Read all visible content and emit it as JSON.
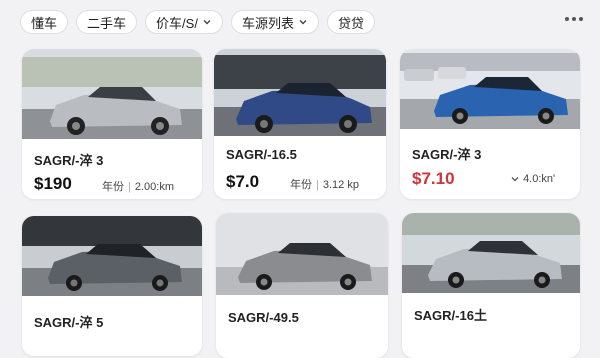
{
  "filters": [
    {
      "label": "懂车",
      "has_chevron": false
    },
    {
      "label": "二手车",
      "has_chevron": false
    },
    {
      "label": "价车/S/",
      "has_chevron": true
    },
    {
      "label": "车源列表",
      "has_chevron": true
    },
    {
      "label": "贷贷",
      "has_chevron": false
    }
  ],
  "listings": [
    {
      "title": "SAGR/-淬 3",
      "price": "$190",
      "age_label": "年份",
      "mileage": "2.00:km",
      "car_color": "#b9bcc0"
    },
    {
      "title": "SAGR/-16.5",
      "price": "$7.0",
      "age_label": "年份",
      "mileage": "3.12 kp",
      "car_color": "#2f4a86"
    },
    {
      "title": "SAGR/-淬 3",
      "price": "$7.10",
      "meta_icon": "chevron-down-icon",
      "mileage": "4.0:kn'",
      "price_color": "#d0333a",
      "car_color": "#2a63b0"
    },
    {
      "title": "SAGR/-淬 5",
      "car_color": "#5b5f66"
    },
    {
      "title": "SAGR/-49.5",
      "car_color": "#8a8c90"
    },
    {
      "title": "SAGR/-16土",
      "car_color": "#b7bbc2"
    }
  ]
}
